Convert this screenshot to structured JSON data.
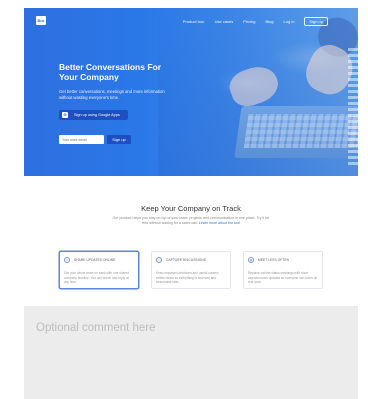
{
  "header": {
    "logo": "Bro",
    "nav": [
      "Product tour",
      "Use cases",
      "Pricing",
      "Blog",
      "Log in"
    ],
    "cta": "Sign up"
  },
  "hero": {
    "title": "Better Conversations For Your Company",
    "description": "Get better conversations, meetings and more information without wasting everyone's time.",
    "google_button": "Sign up using Google Apps",
    "email_placeholder": "Your work email",
    "signup_button": "Sign up"
  },
  "section": {
    "title": "Keep Your Company on Track",
    "description": "Our product helps you stay on top of your team, projects and communication in one place. Try it for free without waiting for a sales call.",
    "link": "Learn more about the tool"
  },
  "cards": [
    {
      "title": "SHARE UPDATES ONLINE",
      "text": "Get your whole team on track with one shared company timeline. You can check and reply at any time."
    },
    {
      "title": "CAPTURE DISCUSSIONS",
      "text": "Keep important decisions and useful context written down so everything is archived and searchable later."
    },
    {
      "title": "MEET LESS OFTEN",
      "text": "Replace routine status meetings with short asynchronous updates so everyone can focus on real work."
    }
  ],
  "comment": {
    "placeholder": "Optional comment here"
  },
  "colors": {
    "hero_blue": "#2f6fe0",
    "button_blue": "#1d4fc2",
    "comment_bg": "#ececec"
  }
}
